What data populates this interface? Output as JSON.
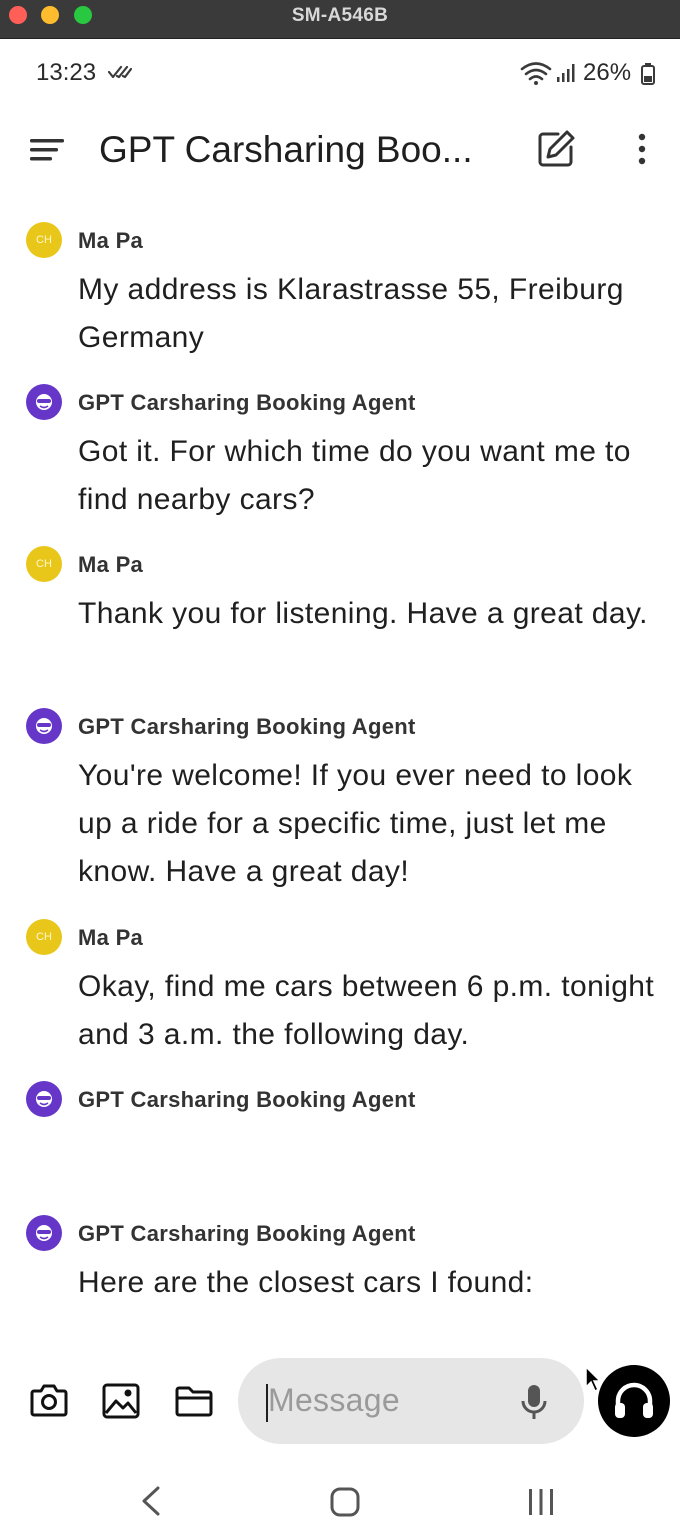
{
  "window": {
    "title": "SM-A546B"
  },
  "status_bar": {
    "time": "13:23",
    "battery": "26%"
  },
  "app_bar": {
    "title": "GPT Carsharing Boo..."
  },
  "messages": [
    {
      "sender": "Ma Pa",
      "avatar": "CH",
      "text": "My address is Klarastrasse 55, Freiburg Germany"
    },
    {
      "sender": "GPT Carsharing Booking Agent",
      "text": "Got it. For which time do you want me to find nearby cars?"
    },
    {
      "sender": "Ma Pa",
      "avatar": "CH",
      "text": "Thank you for listening. Have a great day."
    },
    {
      "sender": "GPT Carsharing Booking Agent",
      "text": "You're welcome! If you ever need to look up a ride for a specific time, just let me know. Have a great day!"
    },
    {
      "sender": "Ma Pa",
      "avatar": "CH",
      "text": "Okay, find me cars between 6 p.m. tonight and 3 a.m. the following day."
    },
    {
      "sender": "GPT Carsharing Booking Agent",
      "text": ""
    },
    {
      "sender": "GPT Carsharing Booking Agent",
      "text": "Here are the closest cars I found:"
    }
  ],
  "composer": {
    "placeholder": "Message"
  },
  "colors": {
    "user_avatar": "#e8c71a",
    "bot_avatar": "#6636c9",
    "input_bg": "#e6e6e6"
  },
  "icons": [
    "menu-icon",
    "edit-icon",
    "more-icon",
    "camera-icon",
    "image-icon",
    "folder-icon",
    "mic-icon",
    "headset-icon",
    "back-icon",
    "home-icon",
    "recents-icon"
  ]
}
